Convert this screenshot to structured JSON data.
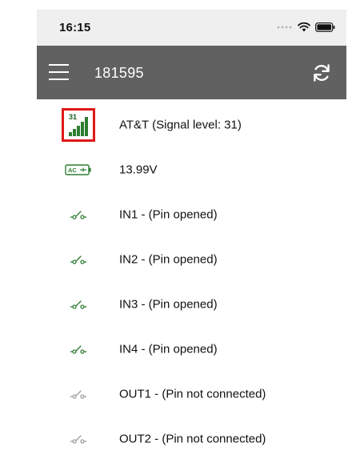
{
  "status_bar": {
    "time": "16:15",
    "icons": [
      "signal-dots-icon",
      "wifi-icon",
      "battery-icon"
    ]
  },
  "app_bar": {
    "title": "181595",
    "menu_icon": "hamburger-menu-icon",
    "refresh_icon": "refresh-icon"
  },
  "colors": {
    "app_bar": "#616161",
    "status_bar": "#efefef",
    "green_active": "#2e7d32",
    "grey_inactive": "#9e9e9e",
    "highlight": "#e01818"
  },
  "rows": [
    {
      "icon": "signal-strength-icon",
      "signal_value": "31",
      "label": "AT&T (Signal level: 31)"
    },
    {
      "icon": "ac-power-icon",
      "icon_text": "AC",
      "label": "13.99V"
    },
    {
      "icon": "switch-open-icon",
      "label": "IN1 - (Pin opened)"
    },
    {
      "icon": "switch-open-icon",
      "label": "IN2 - (Pin opened)"
    },
    {
      "icon": "switch-open-icon",
      "label": "IN3 - (Pin opened)"
    },
    {
      "icon": "switch-open-icon",
      "label": "IN4 - (Pin opened)"
    },
    {
      "icon": "switch-disconnected-icon",
      "label": "OUT1 - (Pin not connected)"
    },
    {
      "icon": "switch-disconnected-icon",
      "label": "OUT2 - (Pin not connected)"
    }
  ]
}
